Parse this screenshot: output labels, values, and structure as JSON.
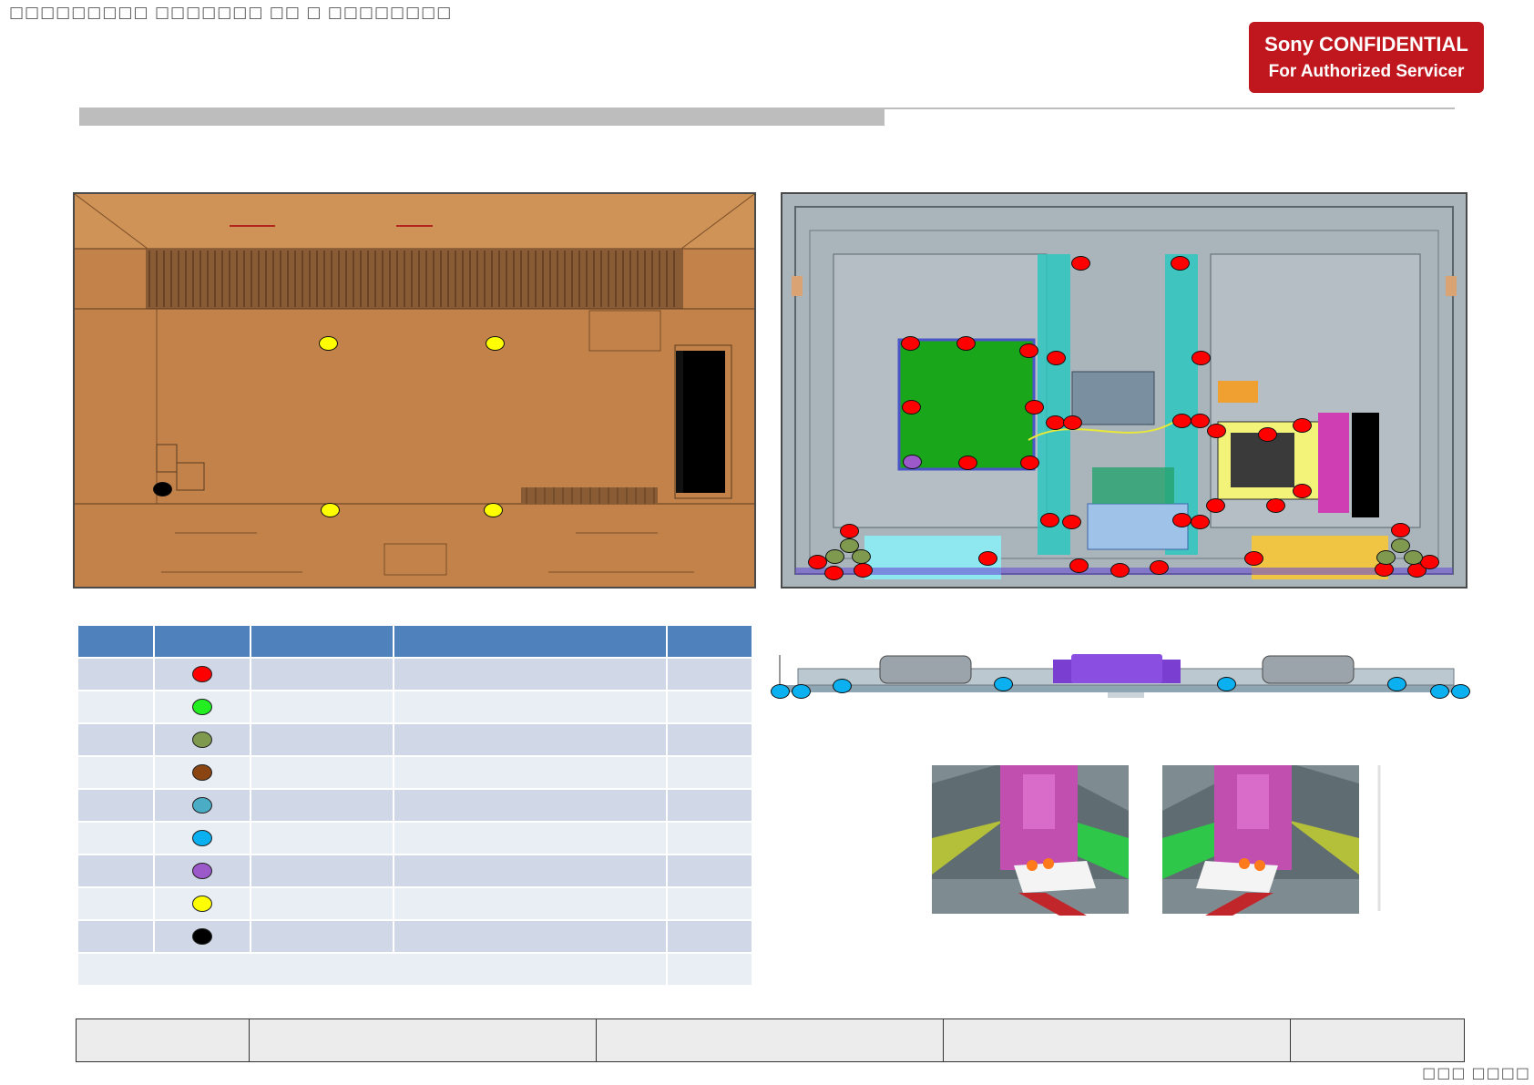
{
  "header": {
    "garbled_title": "□□□□□□□□□ □□□□□□□ □□ □ □□□□□□□□",
    "confidential_line1": "Sony CONFIDENTIAL",
    "confidential_line2": "For Authorized Servicer"
  },
  "diagrams": {
    "rear_view": {
      "screw_markers": [
        "yellow",
        "yellow",
        "yellow",
        "yellow",
        "black"
      ]
    },
    "front_view": {
      "screw_markers": [
        "red",
        "green",
        "olive",
        "purple"
      ]
    },
    "side_profile": {
      "screw_markers": [
        "sky-blue"
      ]
    }
  },
  "legend": {
    "header_cells": [
      "",
      "",
      "",
      "",
      ""
    ],
    "rows": [
      {
        "color": "#ff0000"
      },
      {
        "color": "#22ee22"
      },
      {
        "color": "#7f9a4e"
      },
      {
        "color": "#8b4513"
      },
      {
        "color": "#4bacc6"
      },
      {
        "color": "#0ab0f0"
      },
      {
        "color": "#9b59c9"
      },
      {
        "color": "#ffff00"
      },
      {
        "color": "#000000"
      }
    ]
  },
  "footer": {
    "cells": [
      "",
      "",
      "",
      "",
      ""
    ],
    "page_number": "□□□ □□□□"
  },
  "colors": {
    "badge": "#c0171e",
    "table_header": "#4f81bd",
    "table_row_odd": "#d0d8e8",
    "table_row_even": "#e9edf4",
    "rear_cover": "#c2824a",
    "chassis": "#a9b4bb"
  }
}
